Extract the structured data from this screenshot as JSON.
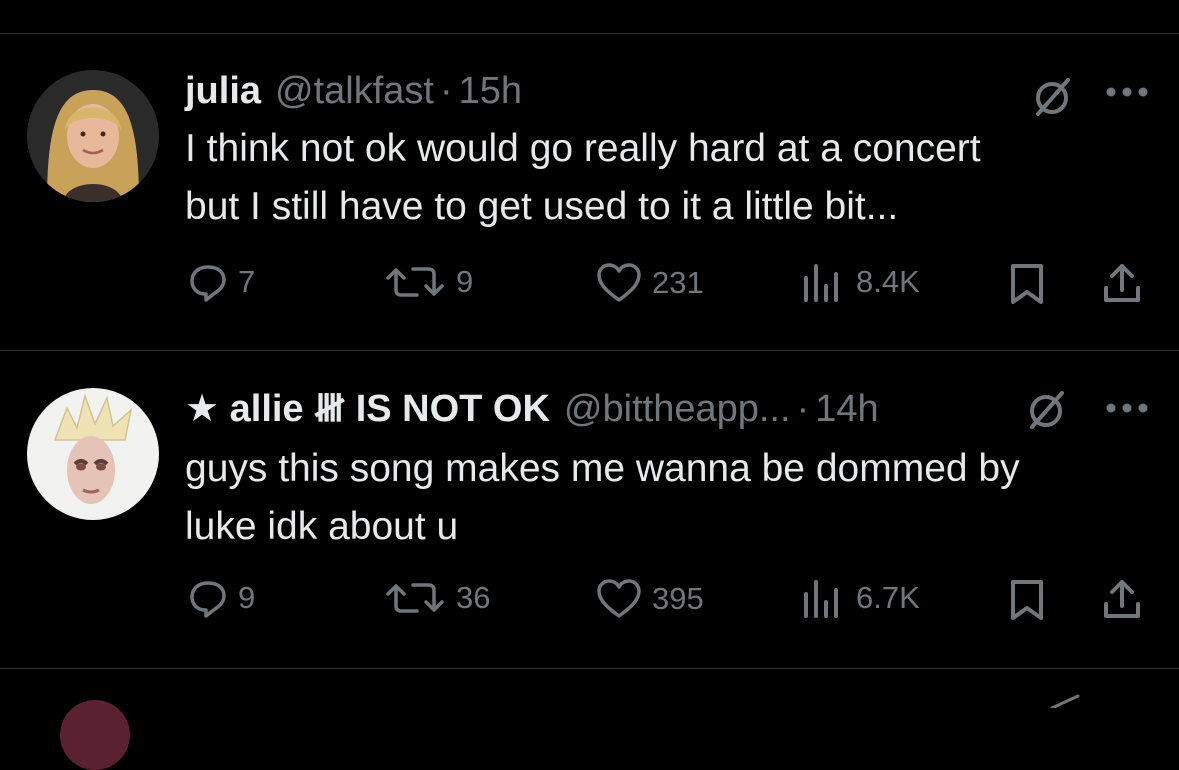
{
  "tweets": [
    {
      "name": "julia",
      "handle": "@talkfast",
      "dot": "·",
      "time": "15h",
      "text_lines": [
        "I think not ok would go really hard at a concert",
        "but I still have to get used to it a little bit..."
      ],
      "replies": "7",
      "reposts": "9",
      "likes": "231",
      "views": "8.4K"
    },
    {
      "name": "★ allie 𝍸 IS NOT OK",
      "handle": "@bittheapp...",
      "dot": "·",
      "time": "14h",
      "text_lines": [
        "guys this song makes me wanna be dommed by",
        "luke idk about u"
      ],
      "replies": "9",
      "reposts": "36",
      "likes": "395",
      "views": "6.7K"
    }
  ],
  "colors": {
    "background": "#000000",
    "text": "#e7e9ea",
    "secondary": "#71767b",
    "divider": "#2f3336"
  },
  "icons": [
    "reply-icon",
    "repost-icon",
    "like-icon",
    "views-icon",
    "bookmark-icon",
    "share-icon",
    "grok-icon",
    "more-icon"
  ]
}
